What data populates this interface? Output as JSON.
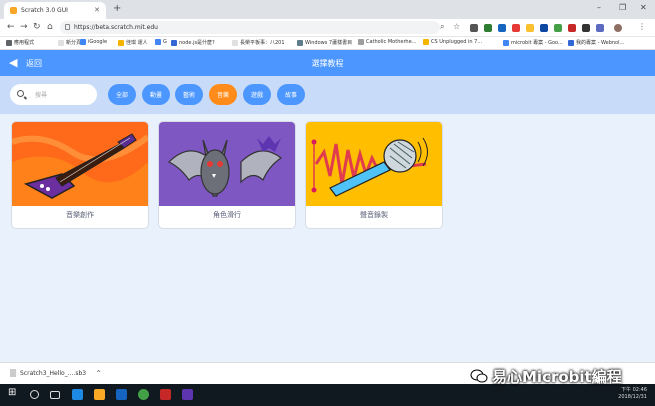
{
  "browser": {
    "tab_title": "Scratch 3.0 GUI",
    "url": "https://beta.scratch.mit.edu",
    "new_tab_symbol": "+",
    "bookmarks": [
      {
        "label": "應用程式",
        "color": "#5f6368"
      },
      {
        "label": "新分頁",
        "color": "#e0e0e0"
      },
      {
        "label": "iGoogle",
        "color": "#4285f4"
      },
      {
        "label": "佳琪 運人",
        "color": "#f4b400"
      },
      {
        "label": "G",
        "color": "#4285f4"
      },
      {
        "label": "node.js是什麼?",
        "color": "#3367d6"
      },
      {
        "label": "長榮平板事：八201",
        "color": "#e0e0e0"
      },
      {
        "label": "Windows 7蘆樣書目",
        "color": "#607d8b"
      },
      {
        "label": "Catholic Motherhe...",
        "color": "#9e9e9e"
      },
      {
        "label": "CS Unplugged in 7...",
        "color": "#f4b400"
      },
      {
        "label": "microbit 專案 - Goo...",
        "color": "#4285f4"
      },
      {
        "label": "我的專案 - Webnol...",
        "color": "#3367d6"
      }
    ]
  },
  "app": {
    "back_label": "返回",
    "page_title": "選擇教程",
    "search_placeholder": "搜尋",
    "categories": [
      {
        "label": "全部",
        "active": false
      },
      {
        "label": "動畫",
        "active": false
      },
      {
        "label": "藝術",
        "active": false
      },
      {
        "label": "音樂",
        "active": true
      },
      {
        "label": "遊戲",
        "active": false
      },
      {
        "label": "故事",
        "active": false
      }
    ],
    "cards": [
      {
        "label": "音樂創作",
        "icon": "electric-guitar"
      },
      {
        "label": "角色滑行",
        "icon": "bat-sprite"
      },
      {
        "label": "聲音錄製",
        "icon": "microphone"
      }
    ],
    "colors": {
      "primary": "#4c97ff",
      "active_pill": "#ff8c1a",
      "filter_bg": "#c8dcfa",
      "content_bg": "#e9f1fc"
    }
  },
  "download": {
    "filename": "Scratch3_Hello_....sb3",
    "chevron": "^"
  },
  "taskbar": {
    "time": "下午 02:46",
    "date": "2018/12/31"
  },
  "watermark": "易心Microbit編程"
}
